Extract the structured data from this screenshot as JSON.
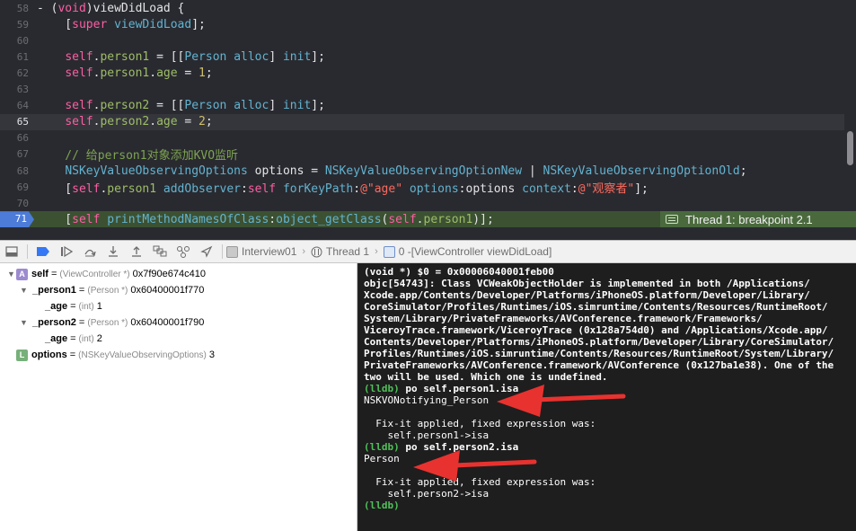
{
  "editor": {
    "lines": [
      {
        "num": "58",
        "tokens": [
          [
            "plain",
            "- ("
          ],
          [
            "kw",
            "void"
          ],
          [
            "plain",
            ")viewDidLoad {"
          ]
        ]
      },
      {
        "num": "59",
        "tokens": [
          [
            "plain",
            "    ["
          ],
          [
            "kw",
            "super"
          ],
          [
            "plain",
            " "
          ],
          [
            "method",
            "viewDidLoad"
          ],
          [
            "plain",
            "];"
          ]
        ]
      },
      {
        "num": "60",
        "tokens": []
      },
      {
        "num": "61",
        "tokens": [
          [
            "plain",
            "    "
          ],
          [
            "kw",
            "self"
          ],
          [
            "plain",
            "."
          ],
          [
            "prop",
            "person1"
          ],
          [
            "plain",
            " = [["
          ],
          [
            "cls",
            "Person"
          ],
          [
            "plain",
            " "
          ],
          [
            "method",
            "alloc"
          ],
          [
            "plain",
            "] "
          ],
          [
            "method",
            "init"
          ],
          [
            "plain",
            "];"
          ]
        ]
      },
      {
        "num": "62",
        "tokens": [
          [
            "plain",
            "    "
          ],
          [
            "kw",
            "self"
          ],
          [
            "plain",
            "."
          ],
          [
            "prop",
            "person1"
          ],
          [
            "plain",
            "."
          ],
          [
            "prop",
            "age"
          ],
          [
            "plain",
            " = "
          ],
          [
            "num",
            "1"
          ],
          [
            "plain",
            ";"
          ]
        ]
      },
      {
        "num": "63",
        "tokens": []
      },
      {
        "num": "64",
        "tokens": [
          [
            "plain",
            "    "
          ],
          [
            "kw",
            "self"
          ],
          [
            "plain",
            "."
          ],
          [
            "prop",
            "person2"
          ],
          [
            "plain",
            " = [["
          ],
          [
            "cls",
            "Person"
          ],
          [
            "plain",
            " "
          ],
          [
            "method",
            "alloc"
          ],
          [
            "plain",
            "] "
          ],
          [
            "method",
            "init"
          ],
          [
            "plain",
            "];"
          ]
        ]
      },
      {
        "num": "65",
        "tokens": [
          [
            "plain",
            "    "
          ],
          [
            "kw",
            "self"
          ],
          [
            "plain",
            "."
          ],
          [
            "prop",
            "person2"
          ],
          [
            "plain",
            "."
          ],
          [
            "prop",
            "age"
          ],
          [
            "plain",
            " = "
          ],
          [
            "num",
            "2"
          ],
          [
            "plain",
            ";"
          ]
        ]
      },
      {
        "num": "66",
        "tokens": []
      },
      {
        "num": "67",
        "tokens": [
          [
            "cmt",
            "    // 给person1对象添加KVO监听"
          ]
        ]
      },
      {
        "num": "68",
        "tokens": [
          [
            "plain",
            "    "
          ],
          [
            "cls",
            "NSKeyValueObservingOptions"
          ],
          [
            "plain",
            " options = "
          ],
          [
            "const",
            "NSKeyValueObservingOptionNew"
          ],
          [
            "plain",
            " | "
          ],
          [
            "const",
            "NSKeyValueObservingOptionOld"
          ],
          [
            "plain",
            ";"
          ]
        ]
      },
      {
        "num": "69",
        "tokens": [
          [
            "plain",
            "    ["
          ],
          [
            "kw",
            "self"
          ],
          [
            "plain",
            "."
          ],
          [
            "prop",
            "person1"
          ],
          [
            "plain",
            " "
          ],
          [
            "method",
            "addObserver"
          ],
          [
            "plain",
            ":"
          ],
          [
            "kw",
            "self"
          ],
          [
            "plain",
            " "
          ],
          [
            "method",
            "forKeyPath"
          ],
          [
            "plain",
            ":"
          ],
          [
            "str",
            "@\"age\""
          ],
          [
            "plain",
            " "
          ],
          [
            "method",
            "options"
          ],
          [
            "plain",
            ":options "
          ],
          [
            "method",
            "context"
          ],
          [
            "plain",
            ":"
          ],
          [
            "str",
            "@\"观察者\""
          ],
          [
            "plain",
            "];"
          ]
        ]
      },
      {
        "num": "70",
        "tokens": []
      },
      {
        "num": "71",
        "tokens": [
          [
            "plain",
            "    ["
          ],
          [
            "kw",
            "self"
          ],
          [
            "plain",
            " "
          ],
          [
            "method",
            "printMethodNamesOfClass"
          ],
          [
            "plain",
            ":"
          ],
          [
            "method",
            "object_getClass"
          ],
          [
            "plain",
            "("
          ],
          [
            "kw",
            "self"
          ],
          [
            "plain",
            "."
          ],
          [
            "prop",
            "person1"
          ],
          [
            "plain",
            ")];"
          ]
        ]
      }
    ],
    "current_line": "65",
    "breakpoint_line": "71",
    "thread_badge": "Thread 1: breakpoint 2.1"
  },
  "debugbar": {
    "crumbs": [
      {
        "label": "Interview01",
        "icon": "app-icon"
      },
      {
        "label": "Thread 1",
        "icon": "thread-icon"
      },
      {
        "label": "0 -[ViewController viewDidLoad]",
        "icon": "frame-icon"
      }
    ]
  },
  "variables": [
    {
      "indent": 0,
      "disclosure": "▼",
      "badge": "A",
      "name": "self",
      "type": "(ViewController *)",
      "value": "0x7f90e674c410"
    },
    {
      "indent": 1,
      "disclosure": "▼",
      "badge": "",
      "name": "_person1",
      "type": "(Person *)",
      "value": "0x60400001f770"
    },
    {
      "indent": 2,
      "disclosure": "",
      "badge": "",
      "name": "_age",
      "type": "(int)",
      "value": "1"
    },
    {
      "indent": 1,
      "disclosure": "▼",
      "badge": "",
      "name": "_person2",
      "type": "(Person *)",
      "value": "0x60400001f790"
    },
    {
      "indent": 2,
      "disclosure": "",
      "badge": "",
      "name": "_age",
      "type": "(int)",
      "value": "2"
    },
    {
      "indent": 0,
      "disclosure": "",
      "badge": "L",
      "name": "options",
      "type": "(NSKeyValueObservingOptions)",
      "value": "3"
    }
  ],
  "console": {
    "lines": [
      {
        "kind": "text",
        "text": "(void *) $0 = 0x00006040001feb00"
      },
      {
        "kind": "text",
        "text": "objc[54743]: Class VCWeakObjectHolder is implemented in both /Applications/"
      },
      {
        "kind": "text",
        "text": "Xcode.app/Contents/Developer/Platforms/iPhoneOS.platform/Developer/Library/"
      },
      {
        "kind": "text",
        "text": "CoreSimulator/Profiles/Runtimes/iOS.simruntime/Contents/Resources/RuntimeRoot/"
      },
      {
        "kind": "text",
        "text": "System/Library/PrivateFrameworks/AVConference.framework/Frameworks/"
      },
      {
        "kind": "text",
        "text": "ViceroyTrace.framework/ViceroyTrace (0x128a754d0) and /Applications/Xcode.app/"
      },
      {
        "kind": "text",
        "text": "Contents/Developer/Platforms/iPhoneOS.platform/Developer/Library/CoreSimulator/"
      },
      {
        "kind": "text",
        "text": "Profiles/Runtimes/iOS.simruntime/Contents/Resources/RuntimeRoot/System/Library/"
      },
      {
        "kind": "text",
        "text": "PrivateFrameworks/AVConference.framework/AVConference (0x127ba1e38). One of the"
      },
      {
        "kind": "text",
        "text": "two will be used. Which one is undefined."
      },
      {
        "kind": "cmd",
        "prompt": "(lldb)",
        "text": " po self.person1.isa"
      },
      {
        "kind": "out",
        "text": "NSKVONotifying_Person"
      },
      {
        "kind": "out",
        "text": ""
      },
      {
        "kind": "out",
        "text": "  Fix-it applied, fixed expression was:"
      },
      {
        "kind": "out",
        "text": "    self.person1->isa"
      },
      {
        "kind": "cmd",
        "prompt": "(lldb)",
        "text": " po self.person2.isa"
      },
      {
        "kind": "out",
        "text": "Person"
      },
      {
        "kind": "out",
        "text": ""
      },
      {
        "kind": "out",
        "text": "  Fix-it applied, fixed expression was:"
      },
      {
        "kind": "out",
        "text": "    self.person2->isa"
      },
      {
        "kind": "cmd",
        "prompt": "(lldb)",
        "text": ""
      }
    ]
  },
  "colors": {
    "editor_bg": "#292a30",
    "breakpoint_line": "#3c5132",
    "breakpoint_arrow": "#4d7bd8",
    "annotation_arrow": "#e8322f",
    "lldb_prompt": "#50c05a"
  }
}
